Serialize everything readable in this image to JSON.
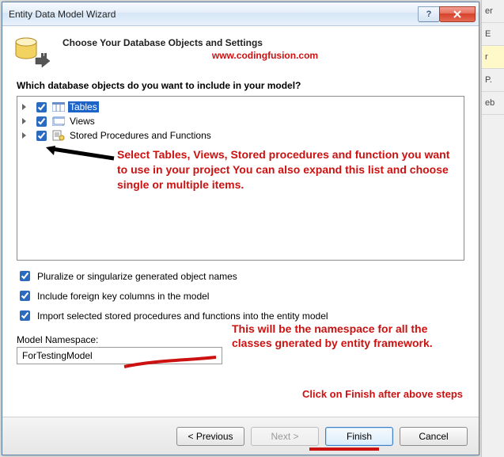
{
  "window": {
    "title": "Entity Data Model Wizard"
  },
  "header": {
    "heading": "Choose Your Database Objects and Settings",
    "url": "www.codingfusion.com"
  },
  "question": "Which database objects do you want to include in your model?",
  "tree": {
    "items": [
      {
        "label": "Tables",
        "selected": true
      },
      {
        "label": "Views",
        "selected": false
      },
      {
        "label": "Stored Procedures and Functions",
        "selected": false
      }
    ]
  },
  "annotations": {
    "tree_note": "Select Tables, Views, Stored procedures and function you want to use in your project You can also expand this list and choose single or multiple items.",
    "namespace_note": "This will be the namespace for all the classes gnerated by entity framework.",
    "finish_note": "Click on Finish after above steps"
  },
  "options": {
    "pluralize": "Pluralize or singularize generated object names",
    "foreign_keys": "Include foreign key columns in the model",
    "import_sp": "Import selected stored procedures and functions into the entity model"
  },
  "namespace": {
    "label": "Model Namespace:",
    "value": "ForTestingModel"
  },
  "buttons": {
    "previous": "< Previous",
    "next": "Next >",
    "finish": "Finish",
    "cancel": "Cancel"
  },
  "sidestrip": {
    "a": "er",
    "b": "E",
    "c": "r",
    "d": "P.",
    "e": "eb"
  }
}
